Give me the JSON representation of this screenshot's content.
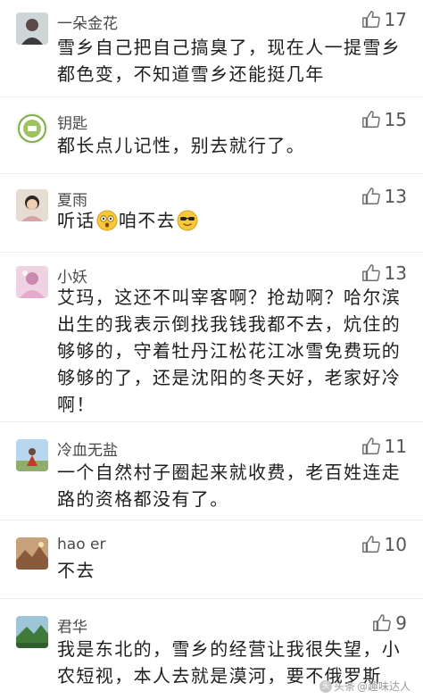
{
  "comments": [
    {
      "username": "一朵金花",
      "likes": "17",
      "avatar_icon": "avatar-person-icon",
      "lines": [
        "雪乡自己把自己搞臭了，现在人一提雪乡",
        "都色变，不知道雪乡还能挺几年"
      ]
    },
    {
      "username": "钥匙",
      "likes": "15",
      "avatar_icon": "avatar-badge-icon",
      "lines": [
        "都长点儿记性，别去就行了。"
      ]
    },
    {
      "username": "夏雨",
      "likes": "13",
      "avatar_icon": "avatar-girl-icon",
      "lines": [
        "听话",
        "咱不去"
      ]
    },
    {
      "username": "小妖",
      "likes": "13",
      "avatar_icon": "avatar-pink-icon",
      "lines": [
        "艾玛，这还不叫宰客啊？抢劫啊？哈尔滨",
        "出生的我表示倒找我钱我都不去，炕住的",
        "够够的，守着牡丹江松花江冰雪免费玩的",
        "够够的了，还是沈阳的冬天好，老家好冷",
        "啊！"
      ]
    },
    {
      "username": "冷血无盐",
      "likes": "11",
      "avatar_icon": "avatar-outdoor-icon",
      "lines": [
        "一个自然村子圈起来就收费，老百姓连走",
        "路的资格都没有了。"
      ]
    },
    {
      "username": "hao er",
      "likes": "10",
      "avatar_icon": "avatar-landscape-icon",
      "lines": [
        "不去"
      ]
    },
    {
      "username": "君华",
      "likes": "9",
      "avatar_icon": "avatar-mountain-icon",
      "lines": [
        "我是东北的，雪乡的经营让我很失望，小",
        "农短视，本人去就是漠河，要不俄罗斯"
      ]
    }
  ],
  "watermark": {
    "brand": "头条",
    "handle": "@趣味达人"
  },
  "colors": {
    "divider": "#ececec",
    "username": "#4a4a4a",
    "like_icon": "#6e6e6e",
    "text": "#1e1e1e"
  }
}
